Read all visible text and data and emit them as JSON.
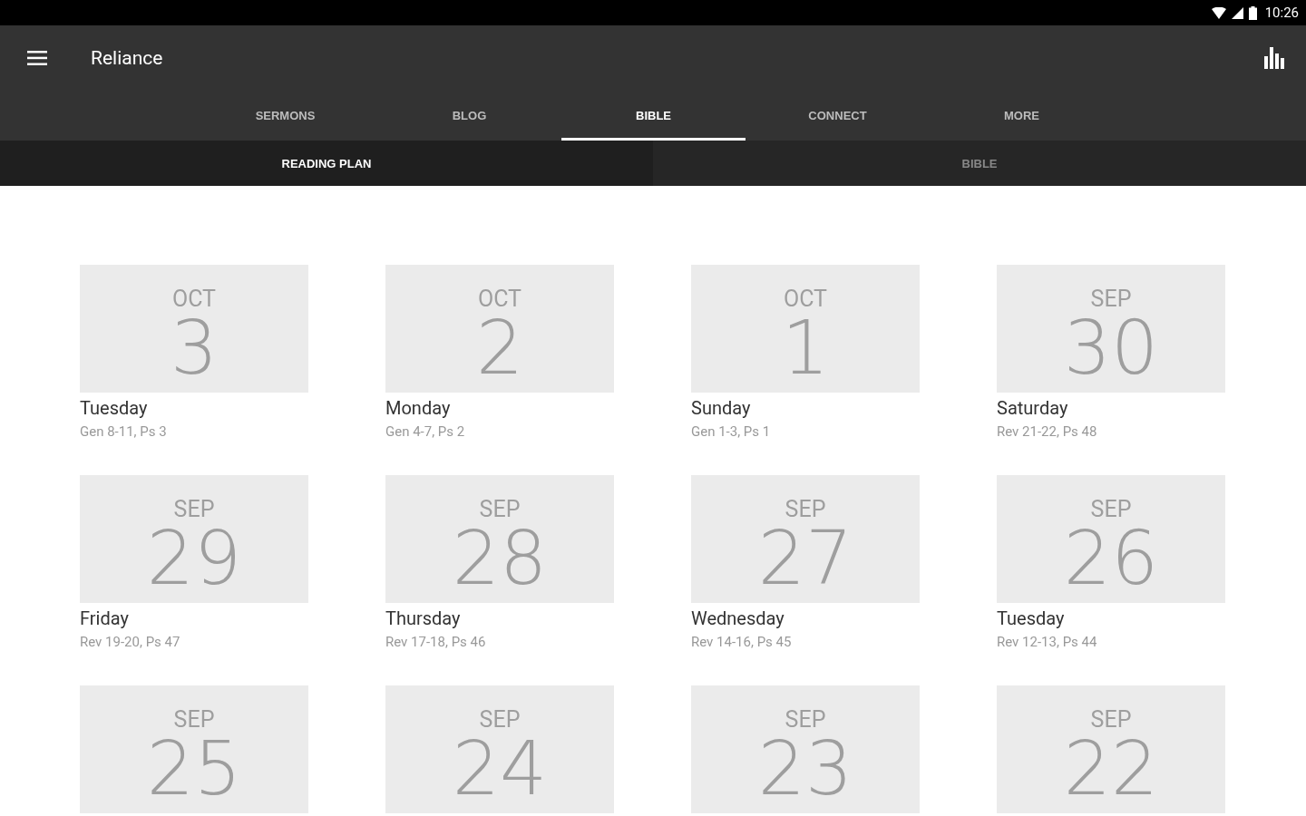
{
  "status_bar": {
    "time": "10:26"
  },
  "app_bar": {
    "title": "Reliance"
  },
  "tabs": [
    {
      "label": "SERMONS",
      "selected": false
    },
    {
      "label": "BLOG",
      "selected": false
    },
    {
      "label": "BIBLE",
      "selected": true
    },
    {
      "label": "CONNECT",
      "selected": false
    },
    {
      "label": "MORE",
      "selected": false
    }
  ],
  "sub_tabs": [
    {
      "label": "READING PLAN",
      "selected": true
    },
    {
      "label": "BIBLE",
      "selected": false
    }
  ],
  "days": [
    {
      "month": "OCT",
      "date": "3",
      "weekday": "Tuesday",
      "reading": "Gen 8-11, Ps 3"
    },
    {
      "month": "OCT",
      "date": "2",
      "weekday": "Monday",
      "reading": "Gen 4-7, Ps 2"
    },
    {
      "month": "OCT",
      "date": "1",
      "weekday": "Sunday",
      "reading": "Gen 1-3, Ps 1"
    },
    {
      "month": "SEP",
      "date": "30",
      "weekday": "Saturday",
      "reading": "Rev 21-22, Ps 48"
    },
    {
      "month": "SEP",
      "date": "29",
      "weekday": "Friday",
      "reading": "Rev 19-20, Ps 47"
    },
    {
      "month": "SEP",
      "date": "28",
      "weekday": "Thursday",
      "reading": "Rev 17-18, Ps 46"
    },
    {
      "month": "SEP",
      "date": "27",
      "weekday": "Wednesday",
      "reading": "Rev 14-16, Ps 45"
    },
    {
      "month": "SEP",
      "date": "26",
      "weekday": "Tuesday",
      "reading": "Rev 12-13, Ps 44"
    },
    {
      "month": "SEP",
      "date": "25"
    },
    {
      "month": "SEP",
      "date": "24"
    },
    {
      "month": "SEP",
      "date": "23"
    },
    {
      "month": "SEP",
      "date": "22"
    }
  ]
}
